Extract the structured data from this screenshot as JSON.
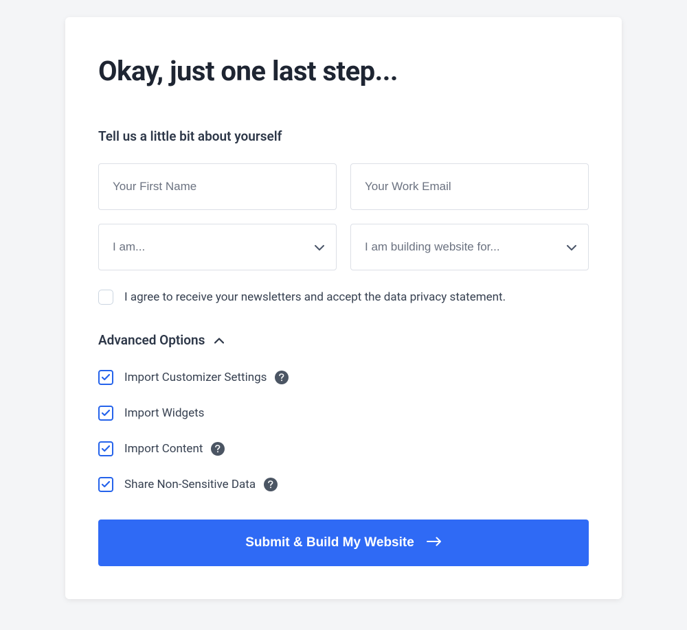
{
  "title": "Okay, just one last step...",
  "subtitle": "Tell us a little bit about yourself",
  "fields": {
    "first_name": {
      "placeholder": "Your First Name",
      "value": ""
    },
    "work_email": {
      "placeholder": "Your Work Email",
      "value": ""
    },
    "role": {
      "placeholder": "I am...",
      "value": ""
    },
    "building_for": {
      "placeholder": "I am building website for...",
      "value": ""
    }
  },
  "consent": {
    "label": "I agree to receive your newsletters and accept the data privacy statement.",
    "checked": false
  },
  "advanced": {
    "label": "Advanced Options",
    "expanded": true,
    "options": [
      {
        "label": "Import Customizer Settings",
        "checked": true,
        "help": true
      },
      {
        "label": "Import Widgets",
        "checked": true,
        "help": false
      },
      {
        "label": "Import Content",
        "checked": true,
        "help": true
      },
      {
        "label": "Share Non-Sensitive Data",
        "checked": true,
        "help": true
      }
    ]
  },
  "submit": {
    "label": "Submit & Build My Website"
  }
}
